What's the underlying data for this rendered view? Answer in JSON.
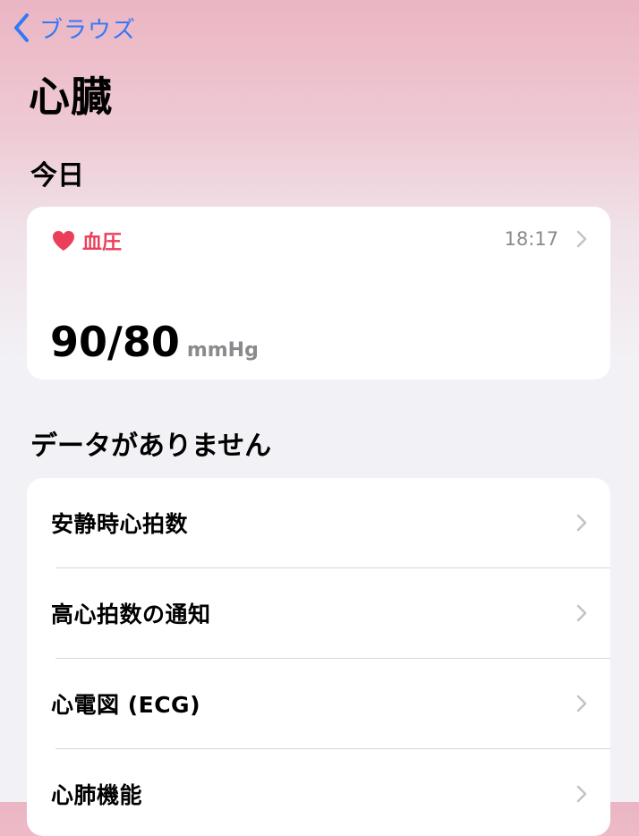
{
  "nav": {
    "back_label": "ブラウズ"
  },
  "page": {
    "title": "心臓"
  },
  "today": {
    "section_title": "今日",
    "card": {
      "category": "血圧",
      "time": "18:17",
      "value": "90/80",
      "unit": "mmHg",
      "icon": "heart-icon",
      "accent_color": "#eb3e5a"
    }
  },
  "no_data": {
    "section_title": "データがありません",
    "items": [
      {
        "label": "安静時心拍数"
      },
      {
        "label": "高心拍数の通知"
      },
      {
        "label": "心電図 (ECG)"
      },
      {
        "label": "心肺機能"
      }
    ]
  },
  "colors": {
    "link": "#3478f6",
    "heart": "#eb3e5a",
    "secondary_text": "#8a8a8e"
  }
}
